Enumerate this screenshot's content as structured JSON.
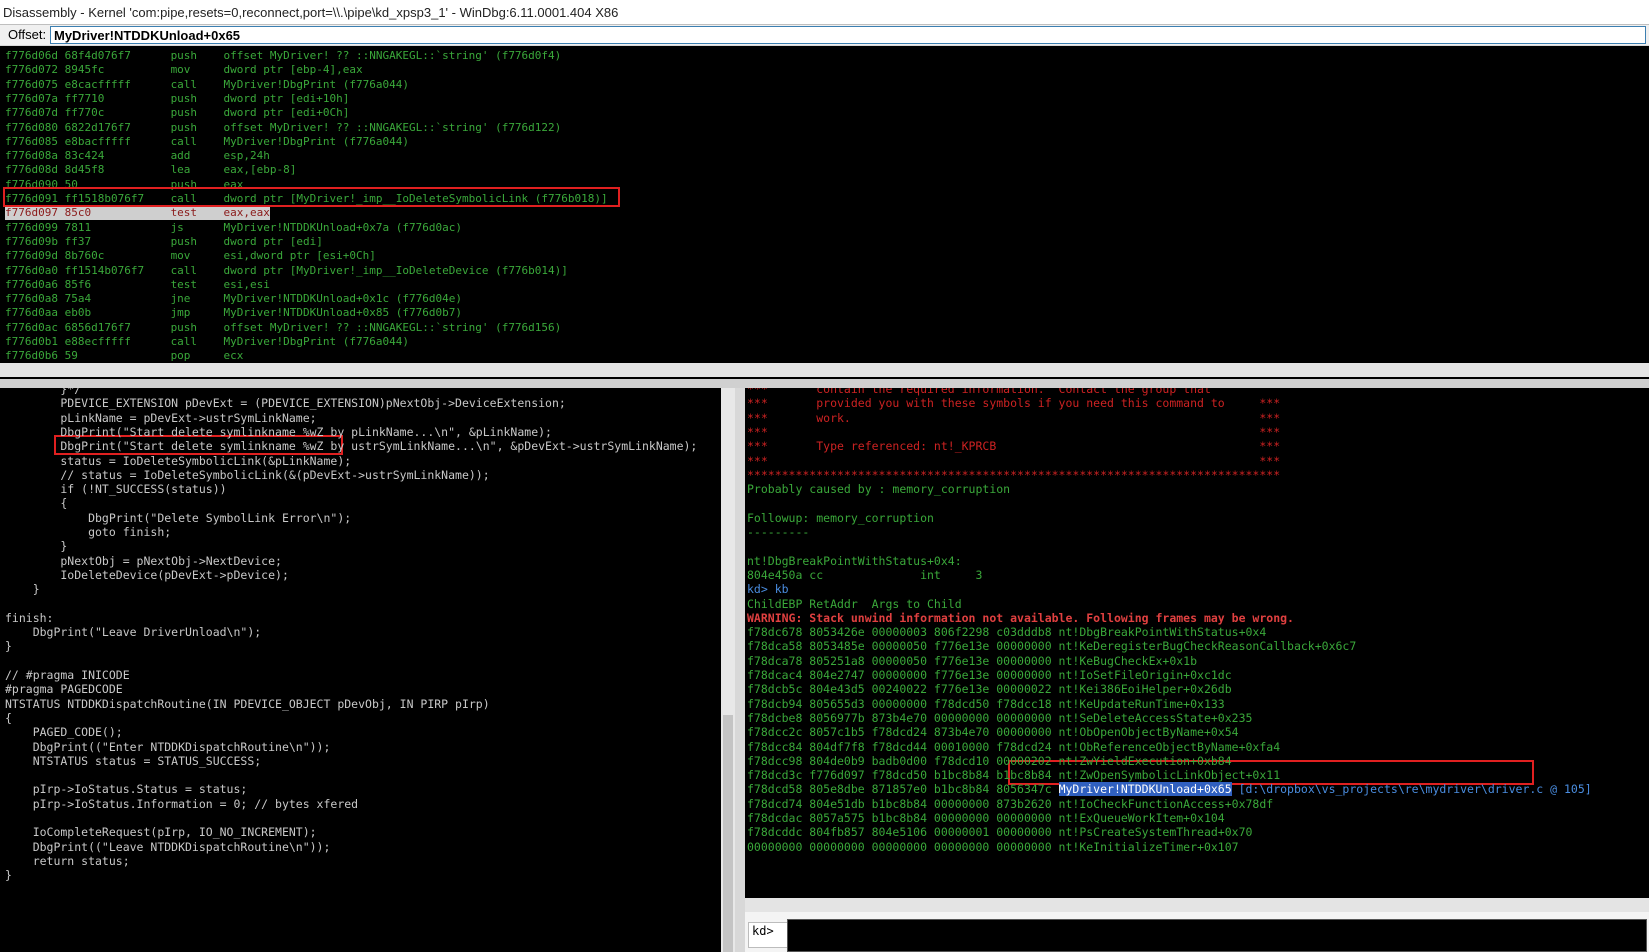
{
  "window": {
    "title": "Disassembly - Kernel 'com:pipe,resets=0,reconnect,port=\\\\.\\pipe\\kd_xpsp3_1' - WinDbg:6.11.0001.404 X86"
  },
  "offset": {
    "label": "Offset:",
    "value": "MyDriver!NTDDKUnload+0x65"
  },
  "disassembly": {
    "lines": [
      "f776d06d 68f4d076f7      push    offset MyDriver! ?? ::NNGAKEGL::`string' (f776d0f4)",
      "f776d072 8945fc          mov     dword ptr [ebp-4],eax",
      "f776d075 e8cacfffff      call    MyDriver!DbgPrint (f776a044)",
      "f776d07a ff7710          push    dword ptr [edi+10h]",
      "f776d07d ff770c          push    dword ptr [edi+0Ch]",
      "f776d080 6822d176f7      push    offset MyDriver! ?? ::NNGAKEGL::`string' (f776d122)",
      "f776d085 e8bacfffff      call    MyDriver!DbgPrint (f776a044)",
      "f776d08a 83c424          add     esp,24h",
      "f776d08d 8d45f8          lea     eax,[ebp-8]",
      "f776d090 50              push    eax",
      "f776d091 ff1518b076f7    call    dword ptr [MyDriver!_imp__IoDeleteSymbolicLink (f776b018)]",
      "f776d097 85c0            test    eax,eax",
      "f776d099 7811            js      MyDriver!NTDDKUnload+0x7a (f776d0ac)",
      "f776d09b ff37            push    dword ptr [edi]",
      "f776d09d 8b760c          mov     esi,dword ptr [esi+0Ch]",
      "f776d0a0 ff1514b076f7    call    dword ptr [MyDriver!_imp__IoDeleteDevice (f776b014)]",
      "f776d0a6 85f6            test    esi,esi",
      "f776d0a8 75a4            jne     MyDriver!NTDDKUnload+0x1c (f776d04e)",
      "f776d0aa eb0b            jmp     MyDriver!NTDDKUnload+0x85 (f776d0b7)",
      "f776d0ac 6856d176f7      push    offset MyDriver! ?? ::NNGAKEGL::`string' (f776d156)",
      "f776d0b1 e88ecfffff      call    MyDriver!DbgPrint (f776a044)",
      "f776d0b6 59              pop     ecx"
    ]
  },
  "source": {
    "lines": [
      "        }*/",
      "        PDEVICE_EXTENSION pDevExt = (PDEVICE_EXTENSION)pNextObj->DeviceExtension;",
      "        pLinkName = pDevExt->ustrSymLinkName;",
      "        DbgPrint(\"Start delete symlinkname %wZ by pLinkName...\\n\", &pLinkName);",
      "        DbgPrint(\"Start delete symlinkname %wZ by ustrSymLinkName...\\n\", &pDevExt->ustrSymLinkName);",
      "        status = IoDeleteSymbolicLink(&pLinkName);",
      "        // status = IoDeleteSymbolicLink(&(pDevExt->ustrSymLinkName));",
      "        if (!NT_SUCCESS(status))",
      "        {",
      "            DbgPrint(\"Delete SymbolLink Error\\n\");",
      "            goto finish;",
      "        }",
      "        pNextObj = pNextObj->NextDevice;",
      "        IoDeleteDevice(pDevExt->pDevice);",
      "    }",
      "",
      "finish:",
      "    DbgPrint(\"Leave DriverUnload\\n\");",
      "}",
      "",
      "// #pragma INICODE",
      "#pragma PAGEDCODE",
      "NTSTATUS NTDDKDispatchRoutine(IN PDEVICE_OBJECT pDevObj, IN PIRP pIrp)",
      "{",
      "    PAGED_CODE();",
      "    DbgPrint((\"Enter NTDDKDispatchRoutine\\n\"));",
      "    NTSTATUS status = STATUS_SUCCESS;",
      "",
      "    pIrp->IoStatus.Status = status;",
      "    pIrp->IoStatus.Information = 0; // bytes xfered",
      "",
      "    IoCompleteRequest(pIrp, IO_NO_INCREMENT);",
      "    DbgPrint((\"Leave NTDDKDispatchRoutine\\n\"));",
      "    return status;",
      "}"
    ]
  },
  "command": {
    "lines": [
      {
        "text": "***       contain the required information.  Contact the group that",
        "style": "red"
      },
      {
        "text": "***       provided you with these symbols if you need this command to     ***",
        "style": "red"
      },
      {
        "text": "***       work.                                                           ***",
        "style": "red"
      },
      {
        "text": "***                                                                       ***",
        "style": "red"
      },
      {
        "text": "***       Type referenced: nt!_KPRCB                                      ***",
        "style": "red"
      },
      {
        "text": "***                                                                       ***",
        "style": "red"
      },
      {
        "text": "*****************************************************************************",
        "style": "red"
      },
      {
        "text": "Probably caused by : memory_corruption",
        "style": "green"
      },
      {
        "text": "",
        "style": "green"
      },
      {
        "text": "Followup: memory_corruption",
        "style": "green"
      },
      {
        "text": "---------",
        "style": "green"
      },
      {
        "text": "",
        "style": "green"
      },
      {
        "text": "nt!DbgBreakPointWithStatus+0x4:",
        "style": "green"
      },
      {
        "text": "804e450a cc              int     3",
        "style": "green"
      },
      {
        "text": "kd> kb",
        "style": "prompt"
      },
      {
        "text": "ChildEBP RetAddr  Args to Child",
        "style": "green"
      },
      {
        "text": "WARNING: Stack unwind information not available. Following frames may be wrong.",
        "style": "redb"
      },
      {
        "text": "f78dc678 8053426e 00000003 806f2298 c03dddb8 nt!DbgBreakPointWithStatus+0x4",
        "style": "green"
      },
      {
        "text": "f78dca58 8053485e 00000050 f776e13e 00000000 nt!KeDeregisterBugCheckReasonCallback+0x6c7",
        "style": "green"
      },
      {
        "text": "f78dca78 805251a8 00000050 f776e13e 00000000 nt!KeBugCheckEx+0x1b",
        "style": "green"
      },
      {
        "text": "f78dcac4 804e2747 00000000 f776e13e 00000000 nt!IoSetFileOrigin+0xc1dc",
        "style": "green"
      },
      {
        "text": "f78dcb5c 804e43d5 00240022 f776e13e 00000022 nt!Kei386EoiHelper+0x26db",
        "style": "green"
      },
      {
        "text": "f78dcb94 805655d3 00000000 f78dcd50 f78dcc18 nt!KeUpdateRunTime+0x133",
        "style": "green"
      },
      {
        "text": "f78dcbe8 8056977b 873b4e70 00000000 00000000 nt!SeDeleteAccessState+0x235",
        "style": "green"
      },
      {
        "text": "f78dcc2c 8057c1b5 f78dcd24 873b4e70 00000000 nt!ObOpenObjectByName+0x54",
        "style": "green"
      },
      {
        "text": "f78dcc84 804df7f8 f78dcd44 00010000 f78dcd24 nt!ObReferenceObjectByName+0xfa4",
        "style": "green"
      },
      {
        "text": "f78dcc98 804de0b9 badb0d00 f78dcd10 00000202 nt!ZwYieldExecution+0xb84",
        "style": "green"
      },
      {
        "text": "f78dcd3c f776d097 f78dcd50 b1bc8b84 b1bc8b84 nt!ZwOpenSymbolicLinkObject+0x11",
        "style": "green"
      },
      {
        "text": "f78dcd58 805e8dbe 871857e0 b1bc8b84 8056347c ",
        "style": "green",
        "link": "MyDriver!NTDDKUnload+0x65",
        "tail": " [d:\\dropbox\\vs_projects\\re\\mydriver\\driver.c @ 105]"
      },
      {
        "text": "f78dcd74 804e51db b1bc8b84 00000000 873b2620 nt!IoCheckFunctionAccess+0x78df",
        "style": "green"
      },
      {
        "text": "f78dcdac 8057a575 b1bc8b84 00000000 00000000 nt!ExQueueWorkItem+0x104",
        "style": "green"
      },
      {
        "text": "f78dcddc 804fb857 804e5106 00000001 00000000 nt!PsCreateSystemThread+0x70",
        "style": "green"
      },
      {
        "text": "00000000 00000000 00000000 00000000 00000000 nt!KeInitializeTimer+0x107",
        "style": "green"
      }
    ],
    "prompt": "kd>"
  }
}
